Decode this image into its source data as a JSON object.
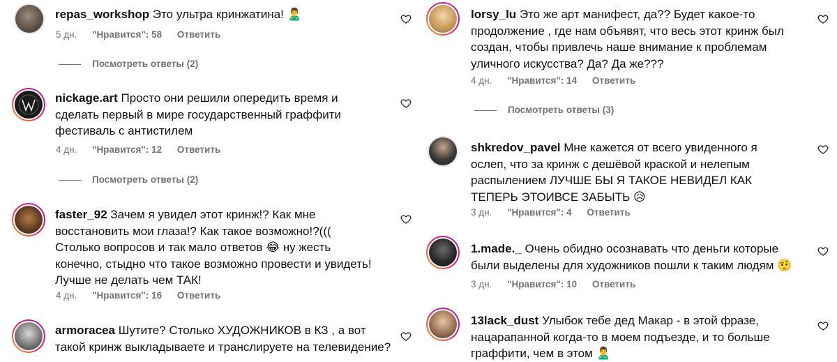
{
  "left": {
    "comments": [
      {
        "username": "repas_workshop",
        "text": "Это ультра кринжатина! 🙎‍♂️",
        "time": "5 дн.",
        "likes": "\"Нравится\": 58",
        "reply": "Ответить",
        "view_replies": "Посмотреть ответы (2)"
      },
      {
        "username": "nickage.art",
        "text": "Просто они решили опередить время и сделать первый в мире государственный граффити фестиваль с антистилем",
        "time": "4 дн.",
        "likes": "\"Нравится\": 12",
        "reply": "Ответить",
        "view_replies": "Посмотреть ответы (2)"
      },
      {
        "username": "faster_92",
        "text": "Зачем я увидел этот кринж!? Как мне восстановить мои глаза!? Как такое возможно!?((( Столько вопросов и так мало ответов 😂 ну жесть конечно, стыдно что такое возможно провести и увидеть! Лучше не делать чем ТАК!",
        "time": "4 дн.",
        "likes": "\"Нравится\": 16",
        "reply": "Ответить"
      },
      {
        "username": "armoracea",
        "text": "Шутите? Столько ХУДОЖНИКОВ в КЗ , а вот такой кринж выкладываете и транслируете на телевидение?"
      }
    ]
  },
  "right": {
    "comments": [
      {
        "username": "lorsy_lu",
        "text": "Это же арт манифест, да?? Будет какое-то продолжение , где нам объявят, что весь этот кринж был создан, чтобы привлечь наше внимание к проблемам уличного искусства? Да? Да же???",
        "time": "4 дн.",
        "likes": "\"Нравится\": 14",
        "reply": "Ответить",
        "view_replies": "Посмотреть ответы (3)"
      },
      {
        "username": "shkredov_pavel",
        "text": "Мне кажется от всего увиденного я ослеп, что за кринж с дешёвой краской и нелепым распылением ЛУЧШЕ БЫ Я ТАКОЕ НЕВИДЕЛ КАК ТЕПЕРЬ ЭТОИВСЕ ЗАБЫТЬ 😥",
        "time": "3 дн.",
        "likes": "\"Нравится\": 4",
        "reply": "Ответить"
      },
      {
        "username": "1.made._",
        "text": "Очень обидно осознавать что деньги которые были выделены для художников пошли к таким людям 🤨",
        "time": "3 дн.",
        "likes": "\"Нравится\": 10",
        "reply": "Ответить"
      },
      {
        "username": "13lack_dust",
        "text": "Улыбок тебе дед Макар - в этой фразе, нацарапанной когда-то в моем подъезде, и то больше граффити, чем в этом 🙎‍♂️"
      }
    ]
  },
  "icons": {
    "like": "heart-outline-icon"
  },
  "colors": {
    "meta_text": "#737373",
    "story_ring": [
      "#f9a825",
      "#e91e63",
      "#9c27b0"
    ]
  }
}
